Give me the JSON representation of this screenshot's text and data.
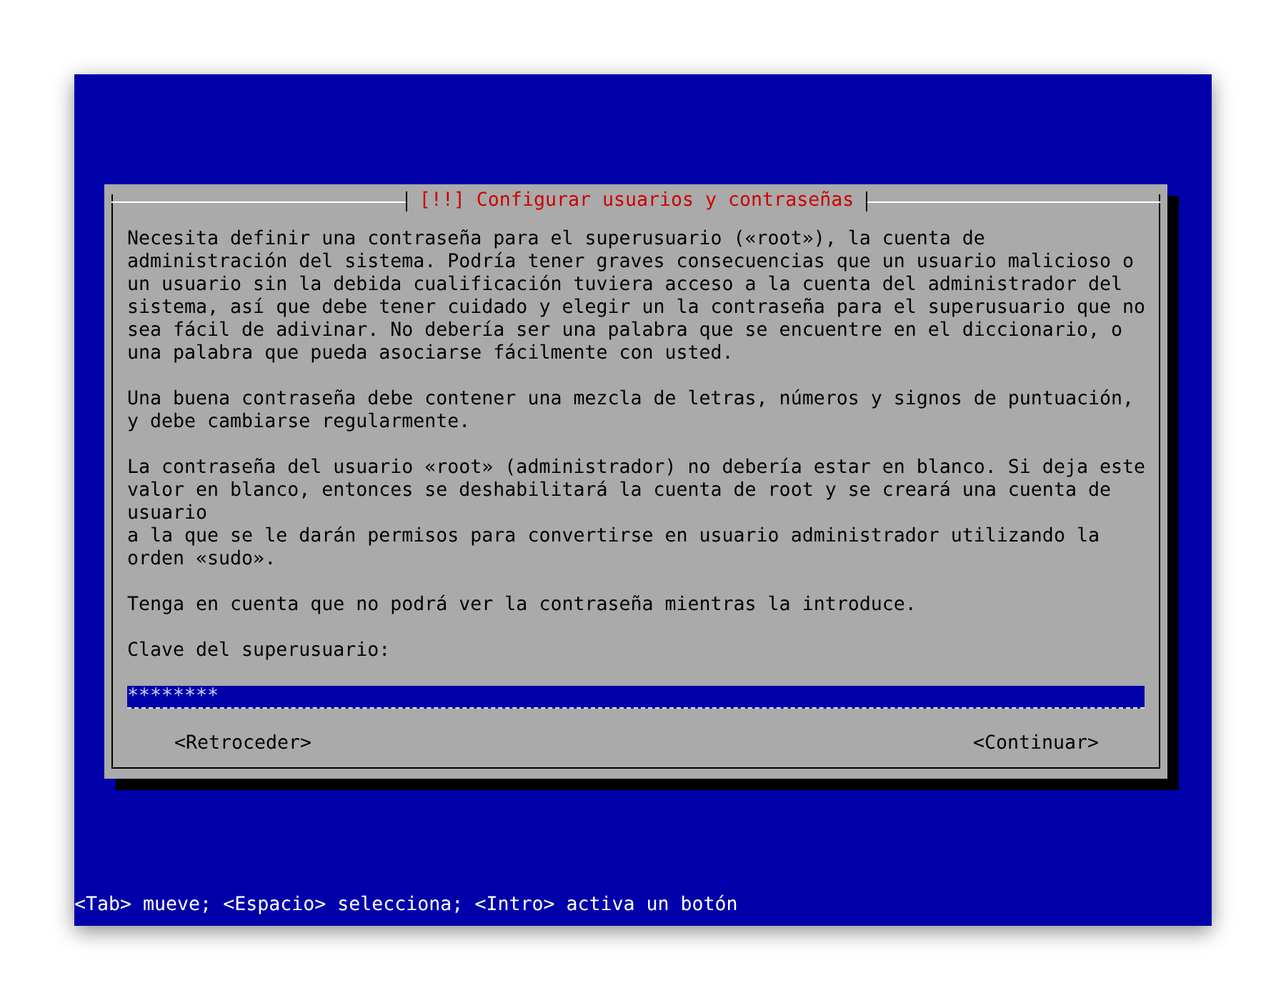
{
  "dialog": {
    "title": "[!!] Configurar usuarios y contraseñas",
    "paragraphs": [
      "Necesita definir una contraseña para el superusuario («root»), la cuenta de\nadministración del sistema. Podría tener graves consecuencias que un usuario malicioso o\nun usuario sin la debida cualificación tuviera acceso a la cuenta del administrador del\nsistema, así que debe tener cuidado y elegir un la contraseña para el superusuario que no\nsea fácil de adivinar. No debería ser una palabra que se encuentre en el diccionario, o\nuna palabra que pueda asociarse fácilmente con usted.",
      "Una buena contraseña debe contener una mezcla de letras, números y signos de puntuación,\ny debe cambiarse regularmente.",
      "La contraseña del usuario «root» (administrador) no debería estar en blanco. Si deja este\nvalor en blanco, entonces se deshabilitará la cuenta de root y se creará una cuenta de usuario\na la que se le darán permisos para convertirse en usuario administrador utilizando la\norden «sudo».",
      "Tenga en cuenta que no podrá ver la contraseña mientras la introduce."
    ],
    "field_label": "Clave del superusuario:",
    "field_value": "********",
    "buttons": [
      "<Retroceder>",
      "<Continuar>"
    ]
  },
  "status_bar": "<Tab> mueve; <Espacio> selecciona; <Intro> activa un botón"
}
